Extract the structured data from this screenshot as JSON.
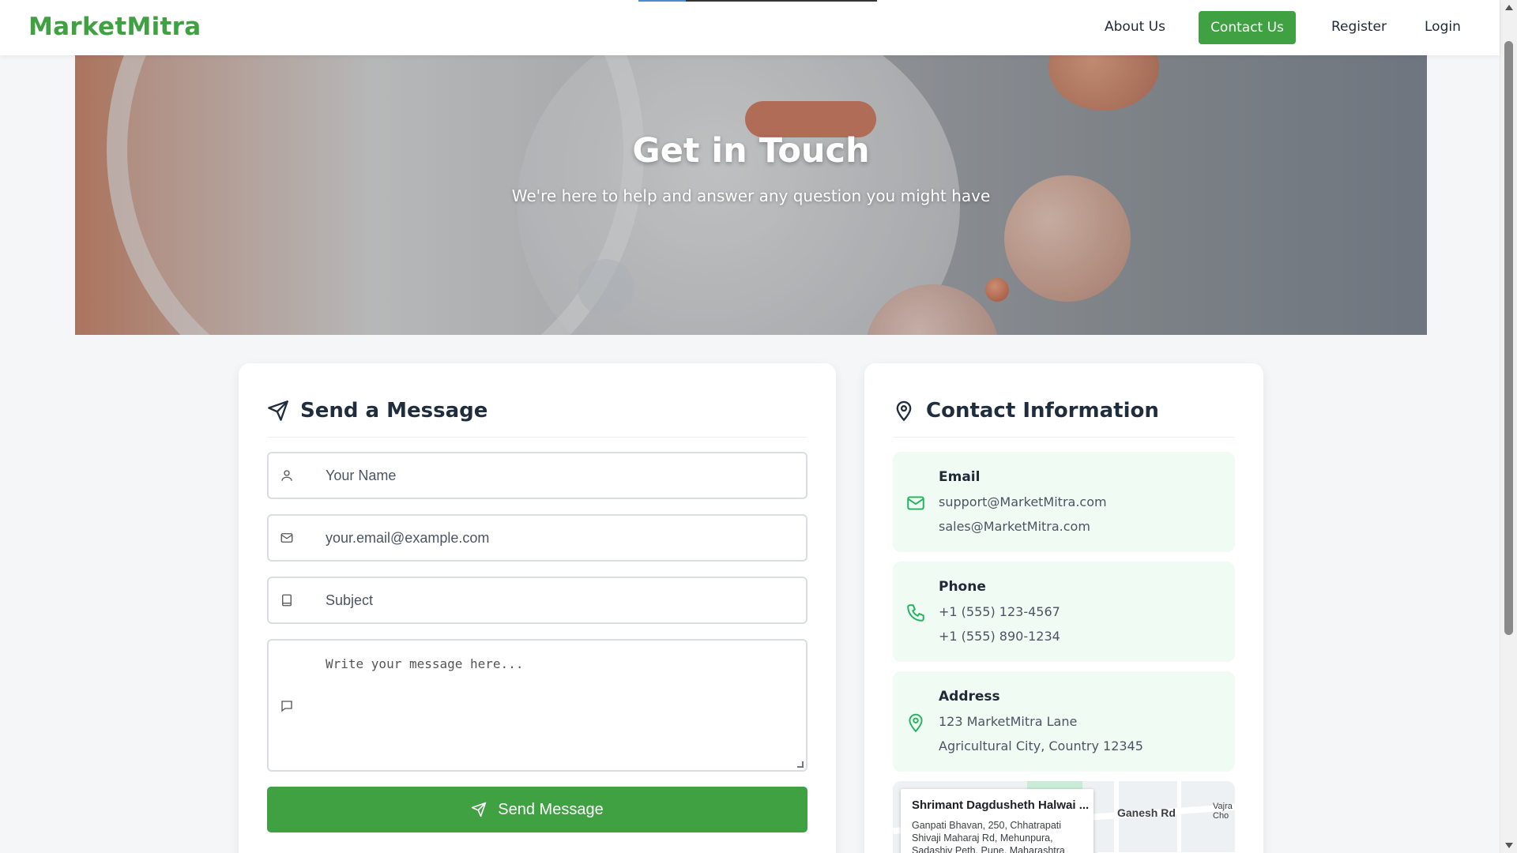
{
  "nav": {
    "brand": "MarketMitra",
    "about": "About Us",
    "contact": "Contact Us",
    "register": "Register",
    "login": "Login"
  },
  "hero": {
    "title": "Get in Touch",
    "subtitle": "We're here to help and answer any question you might have"
  },
  "form": {
    "title": "Send a Message",
    "name_placeholder": "Your Name",
    "email_placeholder": "your.email@example.com",
    "subject_placeholder": "Subject",
    "message_placeholder": "Write your message here...",
    "send_label": "Send Message"
  },
  "info": {
    "title": "Contact Information",
    "email": {
      "label": "Email",
      "lines": [
        "support@MarketMitra.com",
        "sales@MarketMitra.com"
      ]
    },
    "phone": {
      "label": "Phone",
      "lines": [
        "+1 (555) 123-4567",
        "+1 (555) 890-1234"
      ]
    },
    "address": {
      "label": "Address",
      "lines": [
        "123 MarketMitra Lane",
        "Agricultural City, Country 12345"
      ]
    }
  },
  "map": {
    "place_name": "Shrimant Dagdusheth Halwai ...",
    "place_address": "Ganpati Bhavan, 250, Chhatrapati Shivaji Maharaj Rd, Mehunpura, Sadashiv Peth, Pune, Maharashtra",
    "road_label": "Ganesh Rd",
    "corner_label": "Vajra Cho"
  },
  "colors": {
    "brand_green": "#3fa142",
    "info_bg": "#f0fbf3",
    "icon_green": "#22b35e"
  }
}
